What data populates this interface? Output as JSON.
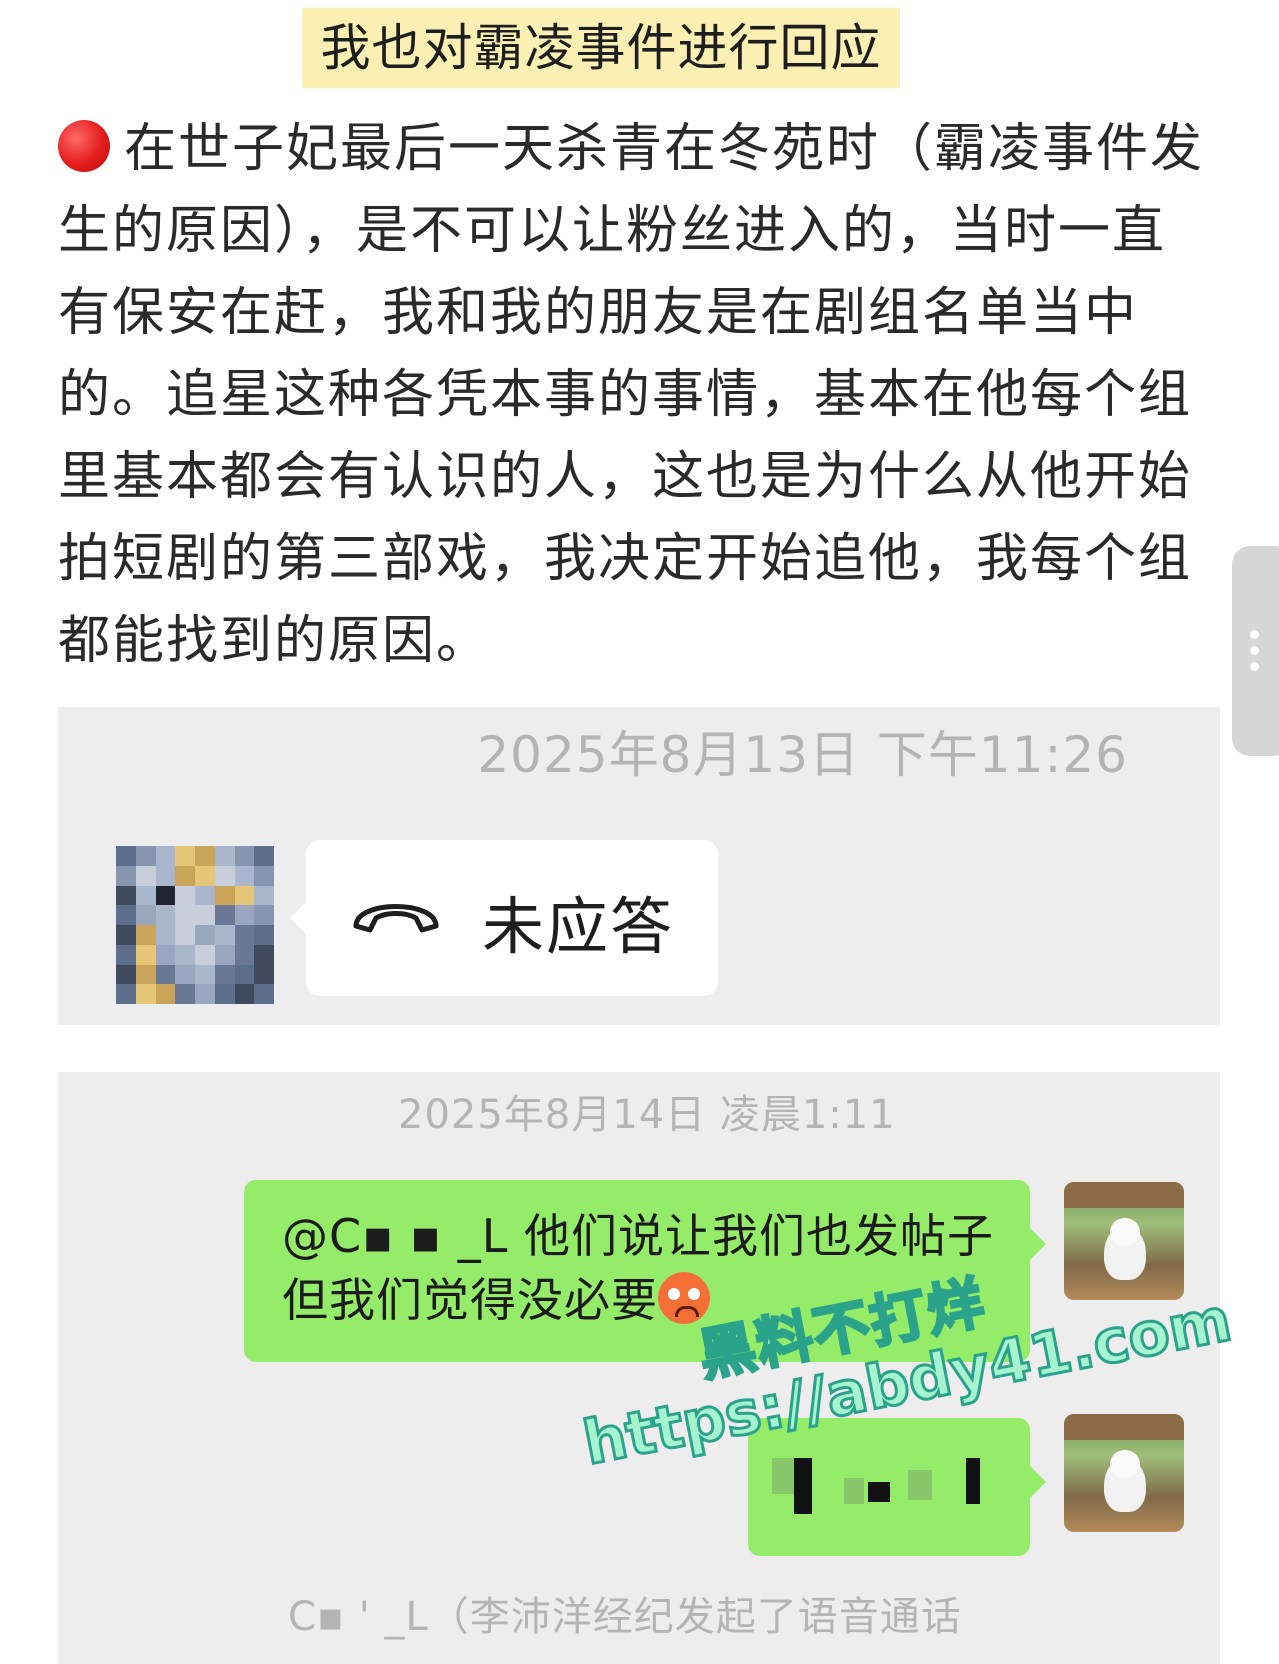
{
  "post": {
    "title": "我也对霸凌事件进行回应",
    "body": "在世子妃最后一天杀青在冬苑时（霸凌事件发生的原因），是不可以让粉丝进入的，当时一直有保安在赶，我和我的朋友是在剧组名单当中的。追星这种各凭本事的事情，基本在他每个组里基本都会有认识的人，这也是为什么从他开始拍短剧的第三部戏，我决定开始追他，我每个组都能找到的原因。"
  },
  "chat1": {
    "timestamp": "2025年8月13日 下午11:26",
    "call_status": "未应答"
  },
  "chat2": {
    "timestamp": "2025年8月14日 凌晨1:11",
    "message_text": "@C▪ ▪ _L 他们说让我们也发帖子 但我们觉得没必要",
    "system_text": "C▪  ' _L（李沛洋经纪发起了语音通话"
  },
  "watermark": {
    "line1": "黑料不打烊",
    "line2": "https://abdy41.com"
  },
  "colors": {
    "highlight": "#fbf0b4",
    "chat_bg": "#ededed",
    "bubble_green": "#95ec69",
    "timestamp_gray": "#b4b4b4"
  }
}
